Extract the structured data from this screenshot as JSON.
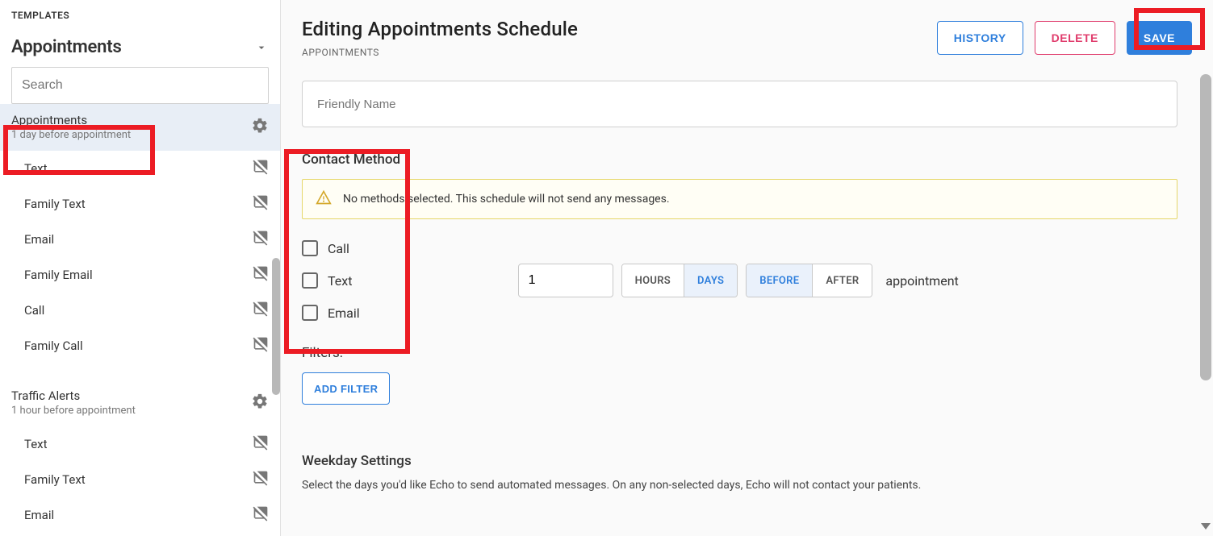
{
  "sidebar": {
    "templates_label": "TEMPLATES",
    "section_title": "Appointments",
    "search_placeholder": "Search",
    "schedules": [
      {
        "title": "Appointments",
        "sub": "1 day before appointment",
        "active": true,
        "templates": [
          "Text",
          "Family Text",
          "Email",
          "Family Email",
          "Call",
          "Family Call"
        ]
      },
      {
        "title": "Traffic Alerts",
        "sub": "1 hour before appointment",
        "active": false,
        "templates": [
          "Text",
          "Family Text",
          "Email"
        ]
      }
    ]
  },
  "main": {
    "title": "Editing Appointments Schedule",
    "breadcrumb": "APPOINTMENTS",
    "buttons": {
      "history": "HISTORY",
      "delete": "DELETE",
      "save": "SAVE"
    },
    "friendly_name": {
      "value": "",
      "placeholder": "Friendly Name"
    },
    "contact_method": {
      "header": "Contact Method",
      "warning": "No methods selected. This schedule will not send any messages.",
      "options": [
        {
          "label": "Call",
          "checked": false
        },
        {
          "label": "Text",
          "checked": false
        },
        {
          "label": "Email",
          "checked": false
        }
      ]
    },
    "timing": {
      "value": "1",
      "unit_options": [
        "HOURS",
        "DAYS"
      ],
      "unit_selected": "DAYS",
      "rel_options": [
        "BEFORE",
        "AFTER"
      ],
      "rel_selected": "BEFORE",
      "suffix": "appointment"
    },
    "filters": {
      "label": "Filters:",
      "add_filter": "ADD FILTER"
    },
    "weekday": {
      "title": "Weekday Settings",
      "desc": "Select the days you'd like Echo to send automated messages. On any non-selected days, Echo will not contact your patients."
    }
  },
  "colors": {
    "accent": "#2f7fdc",
    "danger": "#e03c6c",
    "highlight": "#ec1c24"
  }
}
